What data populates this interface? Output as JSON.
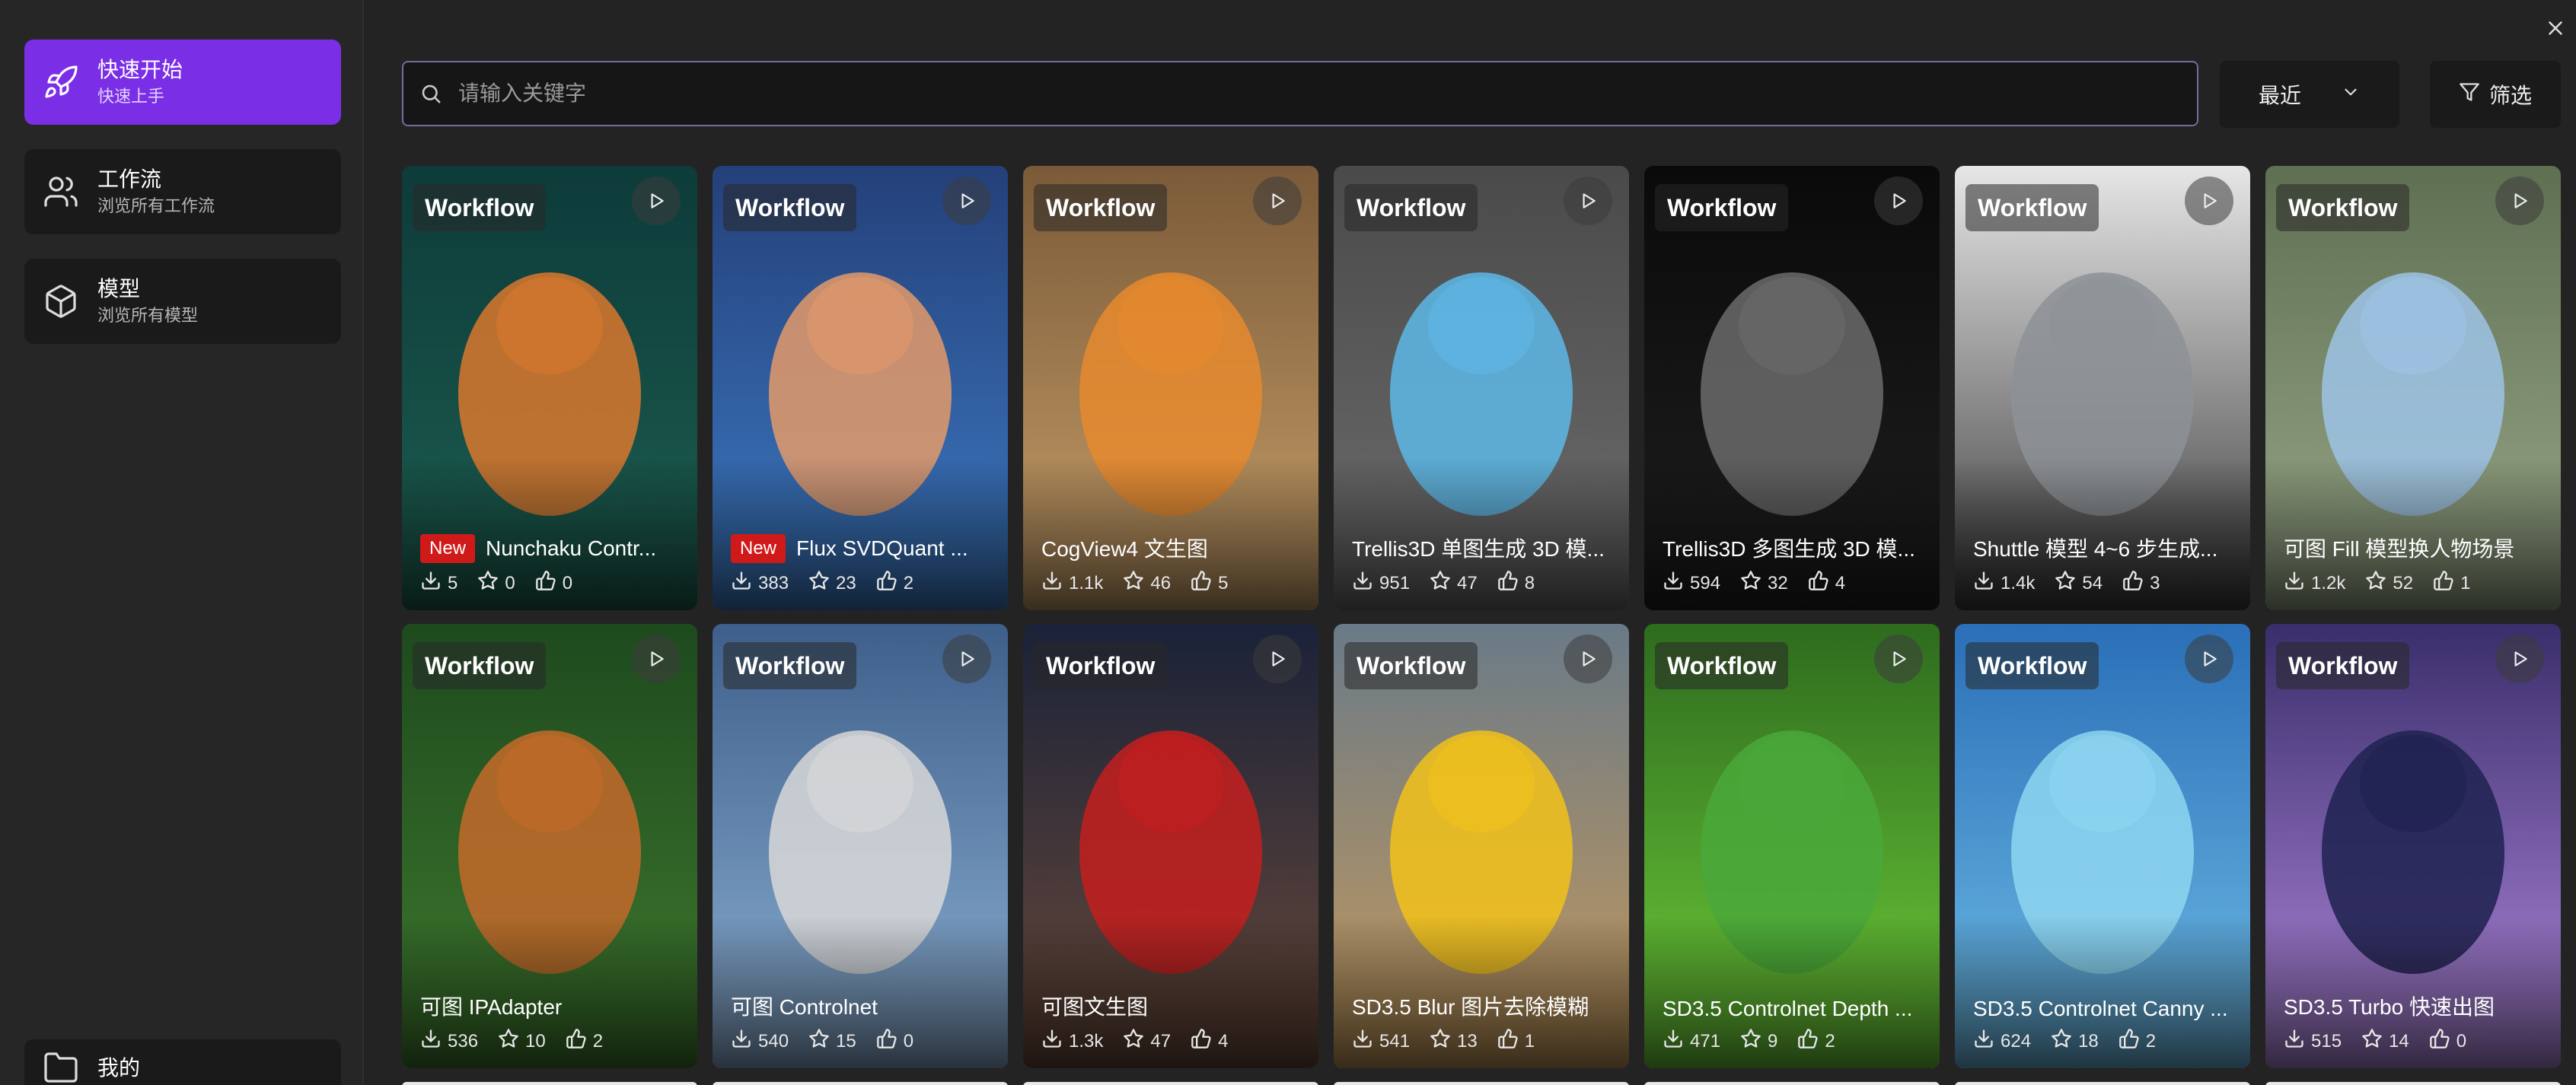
{
  "sidebar": {
    "items": [
      {
        "title": "快速开始",
        "subtitle": "快速上手"
      },
      {
        "title": "工作流",
        "subtitle": "浏览所有工作流"
      },
      {
        "title": "模型",
        "subtitle": "浏览所有模型"
      }
    ],
    "bottom": {
      "title": "我的"
    }
  },
  "search": {
    "placeholder": "请输入关键字"
  },
  "sort": {
    "label": "最近"
  },
  "filter": {
    "label": "筛选"
  },
  "colors": {
    "accent": "#7a2ee6",
    "new_badge": "#d01a1a"
  },
  "cards": [
    {
      "tag": "Workflow",
      "new": "New",
      "title": "Nunchaku Contr...",
      "downloads": "5",
      "stars": "0",
      "likes": "0"
    },
    {
      "tag": "Workflow",
      "new": "New",
      "title": "Flux SVDQuant ...",
      "downloads": "383",
      "stars": "23",
      "likes": "2"
    },
    {
      "tag": "Workflow",
      "new": "",
      "title": "CogView4 文生图",
      "downloads": "1.1k",
      "stars": "46",
      "likes": "5"
    },
    {
      "tag": "Workflow",
      "new": "",
      "title": "Trellis3D 单图生成 3D 模...",
      "downloads": "951",
      "stars": "47",
      "likes": "8"
    },
    {
      "tag": "Workflow",
      "new": "",
      "title": "Trellis3D 多图生成 3D 模...",
      "downloads": "594",
      "stars": "32",
      "likes": "4"
    },
    {
      "tag": "Workflow",
      "new": "",
      "title": "Shuttle 模型 4~6 步生成...",
      "downloads": "1.4k",
      "stars": "54",
      "likes": "3"
    },
    {
      "tag": "Workflow",
      "new": "",
      "title": "可图 Fill 模型换人物场景",
      "downloads": "1.2k",
      "stars": "52",
      "likes": "1"
    },
    {
      "tag": "Workflow",
      "new": "",
      "title": "可图 IPAdapter",
      "downloads": "536",
      "stars": "10",
      "likes": "2"
    },
    {
      "tag": "Workflow",
      "new": "",
      "title": "可图 Controlnet",
      "downloads": "540",
      "stars": "15",
      "likes": "0"
    },
    {
      "tag": "Workflow",
      "new": "",
      "title": "可图文生图",
      "downloads": "1.3k",
      "stars": "47",
      "likes": "4"
    },
    {
      "tag": "Workflow",
      "new": "",
      "title": "SD3.5 Blur 图片去除模糊",
      "downloads": "541",
      "stars": "13",
      "likes": "1"
    },
    {
      "tag": "Workflow",
      "new": "",
      "title": "SD3.5 Controlnet Depth ...",
      "downloads": "471",
      "stars": "9",
      "likes": "2"
    },
    {
      "tag": "Workflow",
      "new": "",
      "title": "SD3.5 Controlnet Canny ...",
      "downloads": "624",
      "stars": "18",
      "likes": "2"
    },
    {
      "tag": "Workflow",
      "new": "",
      "title": "SD3.5 Turbo 快速出图",
      "downloads": "515",
      "stars": "14",
      "likes": "0"
    }
  ],
  "thumb_themes": [
    {
      "bg1": "#0d3b3a",
      "bg2": "#1d5e4f",
      "fg": "#d9782e"
    },
    {
      "bg1": "#24407a",
      "bg2": "#3d7bc4",
      "fg": "#e39a6a"
    },
    {
      "bg1": "#7a5a38",
      "bg2": "#c9a06a",
      "fg": "#e68a2e"
    },
    {
      "bg1": "#4a4a4a",
      "bg2": "#6d6d6d",
      "fg": "#5db8e8"
    },
    {
      "bg1": "#0a0a0a",
      "bg2": "#1f1f1f",
      "fg": "#6b6b6b"
    },
    {
      "bg1": "#e6e6e6",
      "bg2": "#3a3a3a",
      "fg": "#8d9296"
    },
    {
      "bg1": "#5f6f52",
      "bg2": "#9aa98a",
      "fg": "#9ec3e6"
    },
    {
      "bg1": "#1e4a1e",
      "bg2": "#3f7a2e",
      "fg": "#c46a2a"
    },
    {
      "bg1": "#3d5f8a",
      "bg2": "#8fb2d6",
      "fg": "#d8d8d8"
    },
    {
      "bg1": "#1a2238",
      "bg2": "#6b4a3a",
      "fg": "#c41e1e"
    },
    {
      "bg1": "#6a7a88",
      "bg2": "#c79a5a",
      "fg": "#f2c21a"
    },
    {
      "bg1": "#2e6b1e",
      "bg2": "#6fcf3a",
      "fg": "#4aa83a"
    },
    {
      "bg1": "#2a6fb8",
      "bg2": "#6fbde6",
      "fg": "#8ed6f0"
    },
    {
      "bg1": "#3a2e6b",
      "bg2": "#b38ae0",
      "fg": "#1e2250"
    }
  ]
}
